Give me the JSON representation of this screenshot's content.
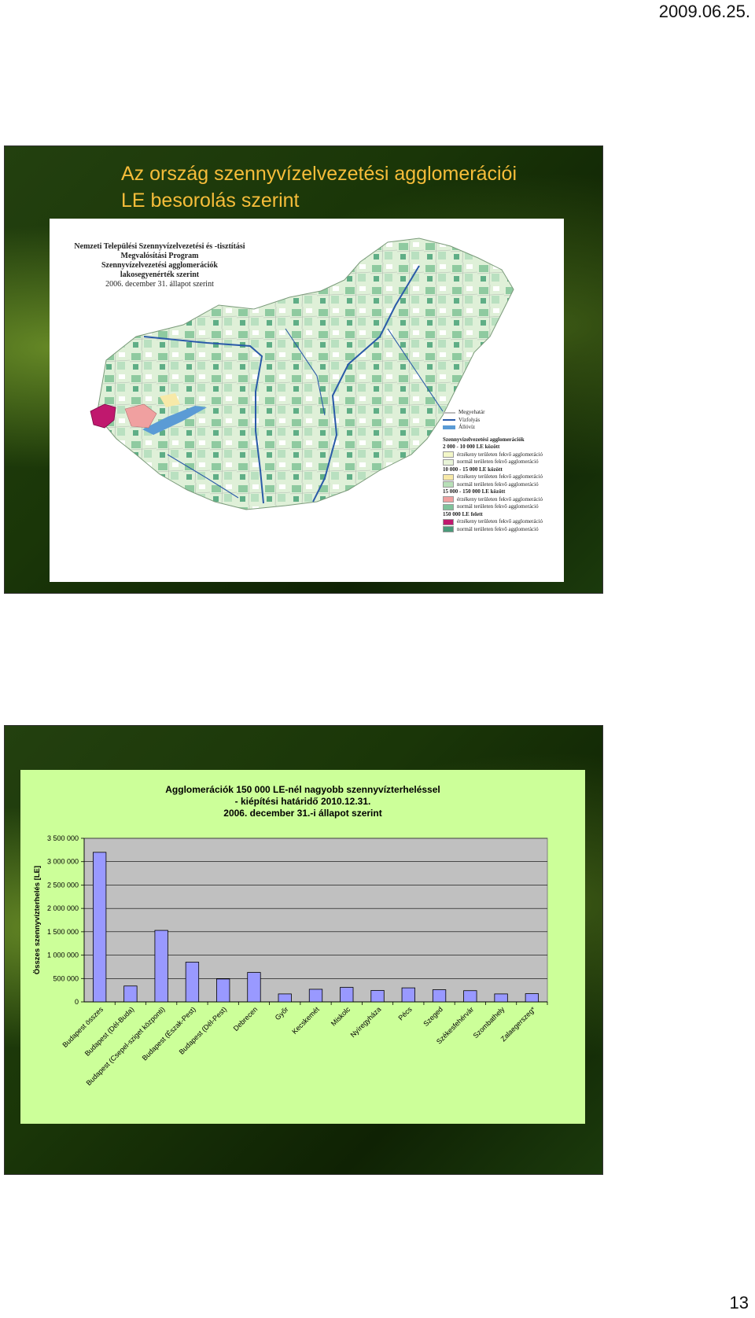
{
  "page": {
    "date": "2009.06.25.",
    "number": "13"
  },
  "slide1": {
    "title_line1": "Az ország szennyvízelvezetési agglomerációi",
    "title_line2": "LE besorolás szerint",
    "map": {
      "caption": [
        "Nemzeti Települési Szennyvízelvezetési és -tisztítási",
        "Megvalósítási Program",
        "Szennyvízelvezetési agglomerációk",
        "lakosegyenérték szerint",
        "2006. december 31. állapot szerint"
      ],
      "legend_lines": [
        {
          "label": "Megyehatár",
          "color": "#bbbbbb"
        },
        {
          "label": "Vízfolyás",
          "color": "#2a5aa8"
        },
        {
          "label": "Állóvíz",
          "color": "#5b9bd5"
        }
      ],
      "legend_title": "Szennyvízelvezetési agglomerációk",
      "legend_groups": [
        {
          "head": "2 000 - 10 000 LE között",
          "items": [
            {
              "label": "érzékeny területen fekvő agglomeráció",
              "color": "#f3f7c8"
            },
            {
              "label": "normál területen fekvő agglomeráció",
              "color": "#e8f4d8"
            }
          ]
        },
        {
          "head": "10 000 - 15 000 LE között",
          "items": [
            {
              "label": "érzékeny területen fekvő agglomeráció",
              "color": "#f7e9a8"
            },
            {
              "label": "normál területen fekvő agglomeráció",
              "color": "#b8e0b8"
            }
          ]
        },
        {
          "head": "15 000 - 150 000 LE között",
          "items": [
            {
              "label": "érzékeny területen fekvő agglomeráció",
              "color": "#f0a0a0"
            },
            {
              "label": "normál területen fekvő agglomeráció",
              "color": "#7fc29a"
            }
          ]
        },
        {
          "head": "150 000 LE felett",
          "items": [
            {
              "label": "érzékeny területen fekvő agglomeráció",
              "color": "#c0186e"
            },
            {
              "label": "normál területen fekvő agglomeráció",
              "color": "#4a9a7a"
            }
          ]
        }
      ]
    }
  },
  "slide2": {
    "title_line1": "Agglomerációk 150 000 LE-nél nagyobb szennyvízterheléssel",
    "title_line2": "- kiépítési határidő 2010.12.31.",
    "title_line3": "2006. december 31.-i állapot szerint"
  },
  "chart_data": {
    "type": "bar",
    "ylabel": "Összes szennyvízterhelés [LE]",
    "ylim": [
      0,
      3500000
    ],
    "yticks": [
      0,
      500000,
      1000000,
      1500000,
      2000000,
      2500000,
      3000000,
      3500000
    ],
    "ytick_labels": [
      "0",
      "500 000",
      "1 000 000",
      "1 500 000",
      "2 000 000",
      "2 500 000",
      "3 000 000",
      "3 500 000"
    ],
    "grid": true,
    "bar_color": "#9999ff",
    "categories": [
      "Budapest összes",
      "Budapest (Dél-Buda)",
      "Budapest (Csepel-sziget központi)",
      "Budapest (Észak-Pest)",
      "Budapest (Dél-Pest)",
      "Debrecen",
      "Győr",
      "Kecskemét",
      "Miskolc",
      "Nyíregyháza",
      "Pécs",
      "Szeged",
      "Székesfehérvár",
      "Szombathely",
      "Zalaegerszeg*"
    ],
    "values": [
      3200000,
      340000,
      1530000,
      850000,
      490000,
      630000,
      170000,
      270000,
      310000,
      245000,
      300000,
      260000,
      240000,
      170000,
      175000
    ]
  }
}
